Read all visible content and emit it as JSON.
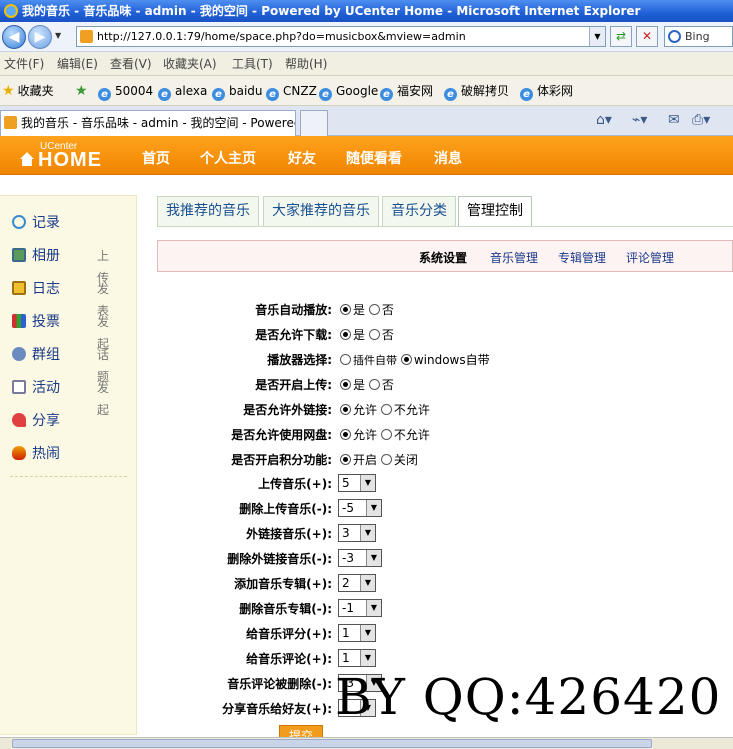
{
  "window_title": "我的音乐 - 音乐品味 - admin - 我的空间 - Powered by UCenter Home - Microsoft Internet Explorer",
  "address": "http://127.0.0.1:79/home/space.php?do=musicbox&mview=admin",
  "search_box": "Bing",
  "menu": [
    "文件(F)",
    "编辑(E)",
    "查看(V)",
    "收藏夹(A)",
    "工具(T)",
    "帮助(H)"
  ],
  "favorites": {
    "label": "收藏夹",
    "links": [
      "50004",
      "alexa",
      "baidu",
      "CNZZ",
      "Google",
      "福安网",
      "破解拷贝",
      "体彩网"
    ]
  },
  "browser_tab": "我的音乐 - 音乐品味 - admin - 我的空间 - Powered ...",
  "logo": {
    "top": "UCenter",
    "main": "HOME"
  },
  "header_nav": [
    "首页",
    "个人主页",
    "好友",
    "随便看看",
    "消息"
  ],
  "sidebar": [
    {
      "label": "记录",
      "sub": ""
    },
    {
      "label": "相册",
      "sub": "上传"
    },
    {
      "label": "日志",
      "sub": "发表"
    },
    {
      "label": "投票",
      "sub": "发起"
    },
    {
      "label": "群组",
      "sub": "话题"
    },
    {
      "label": "活动",
      "sub": "发起"
    },
    {
      "label": "分享",
      "sub": ""
    },
    {
      "label": "热闹",
      "sub": ""
    }
  ],
  "page_tabs": [
    "我推荐的音乐",
    "大家推荐的音乐",
    "音乐分类",
    "管理控制"
  ],
  "sub_nav": [
    "系统设置",
    "音乐管理",
    "专辑管理",
    "评论管理"
  ],
  "radio_fields": [
    {
      "label": "音乐自动播放:",
      "opt1": "是",
      "opt2": "否"
    },
    {
      "label": "是否允许下载:",
      "opt1": "是",
      "opt2": "否"
    },
    {
      "label": "播放器选择:",
      "opt1": "插件自带",
      "opt2": "windows自带"
    },
    {
      "label": "是否开启上传:",
      "opt1": "是",
      "opt2": "否"
    },
    {
      "label": "是否允许外链接:",
      "opt1": "允许",
      "opt2": "不允许"
    },
    {
      "label": "是否允许使用网盘:",
      "opt1": "允许",
      "opt2": "不允许"
    },
    {
      "label": "是否开启积分功能:",
      "opt1": "开启",
      "opt2": "关闭"
    }
  ],
  "select_fields": [
    {
      "label": "上传音乐(+):",
      "value": "5"
    },
    {
      "label": "删除上传音乐(-):",
      "value": "-5"
    },
    {
      "label": "外链接音乐(+):",
      "value": "3"
    },
    {
      "label": "删除外链接音乐(-):",
      "value": "-3"
    },
    {
      "label": "添加音乐专辑(+):",
      "value": "2"
    },
    {
      "label": "删除音乐专辑(-):",
      "value": "-1"
    },
    {
      "label": "给音乐评分(+):",
      "value": "1"
    },
    {
      "label": "给音乐评论(+):",
      "value": "1"
    },
    {
      "label": "音乐评论被删除(-):",
      "value": "-3"
    },
    {
      "label": "分享音乐给好友(+):",
      "value": "1"
    }
  ],
  "submit": "提交",
  "watermark": "BY QQ:426420"
}
